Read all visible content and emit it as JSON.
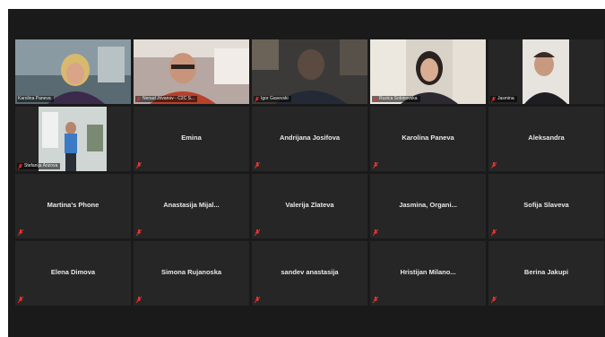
{
  "participants": [
    {
      "name": "Karolina Paneva",
      "video": true,
      "active": true,
      "muted": false
    },
    {
      "name": "Nenad Jovanov - C2C S...",
      "video": true,
      "active": false,
      "muted": true
    },
    {
      "name": "Igor Gavevski",
      "video": true,
      "active": false,
      "muted": true
    },
    {
      "name": "Ruzica Sobinovska",
      "video": true,
      "active": false,
      "muted": true
    },
    {
      "name": "Jasmina",
      "video": true,
      "active": false,
      "muted": true
    },
    {
      "name": "Stefanija Arizova",
      "video": true,
      "active": false,
      "muted": true
    },
    {
      "name": "Emina",
      "video": false,
      "muted": true
    },
    {
      "name": "Andrijana Josifova",
      "video": false,
      "muted": true
    },
    {
      "name": "Karolina Paneva",
      "video": false,
      "muted": true
    },
    {
      "name": "Aleksandra",
      "video": false,
      "muted": true
    },
    {
      "name": "Martina's Phone",
      "video": false,
      "muted": true
    },
    {
      "name": "Anastasija Mijal...",
      "video": false,
      "muted": true
    },
    {
      "name": "Valerija Zlateva",
      "video": false,
      "muted": true
    },
    {
      "name": "Jasmina, Organi...",
      "video": false,
      "muted": true
    },
    {
      "name": "Sofija Slaveva",
      "video": false,
      "muted": true
    },
    {
      "name": "Elena Dimova",
      "video": false,
      "muted": true
    },
    {
      "name": "Simona Rujanoska",
      "video": false,
      "muted": true
    },
    {
      "name": "sandev anastasija",
      "video": false,
      "muted": true
    },
    {
      "name": "Hristijan Milano...",
      "video": false,
      "muted": true
    },
    {
      "name": "Berina Jakupi",
      "video": false,
      "muted": true
    }
  ],
  "colors": {
    "active_border": "#a7d129",
    "mute_icon": "#e5322d",
    "tile_bg": "#262626"
  }
}
